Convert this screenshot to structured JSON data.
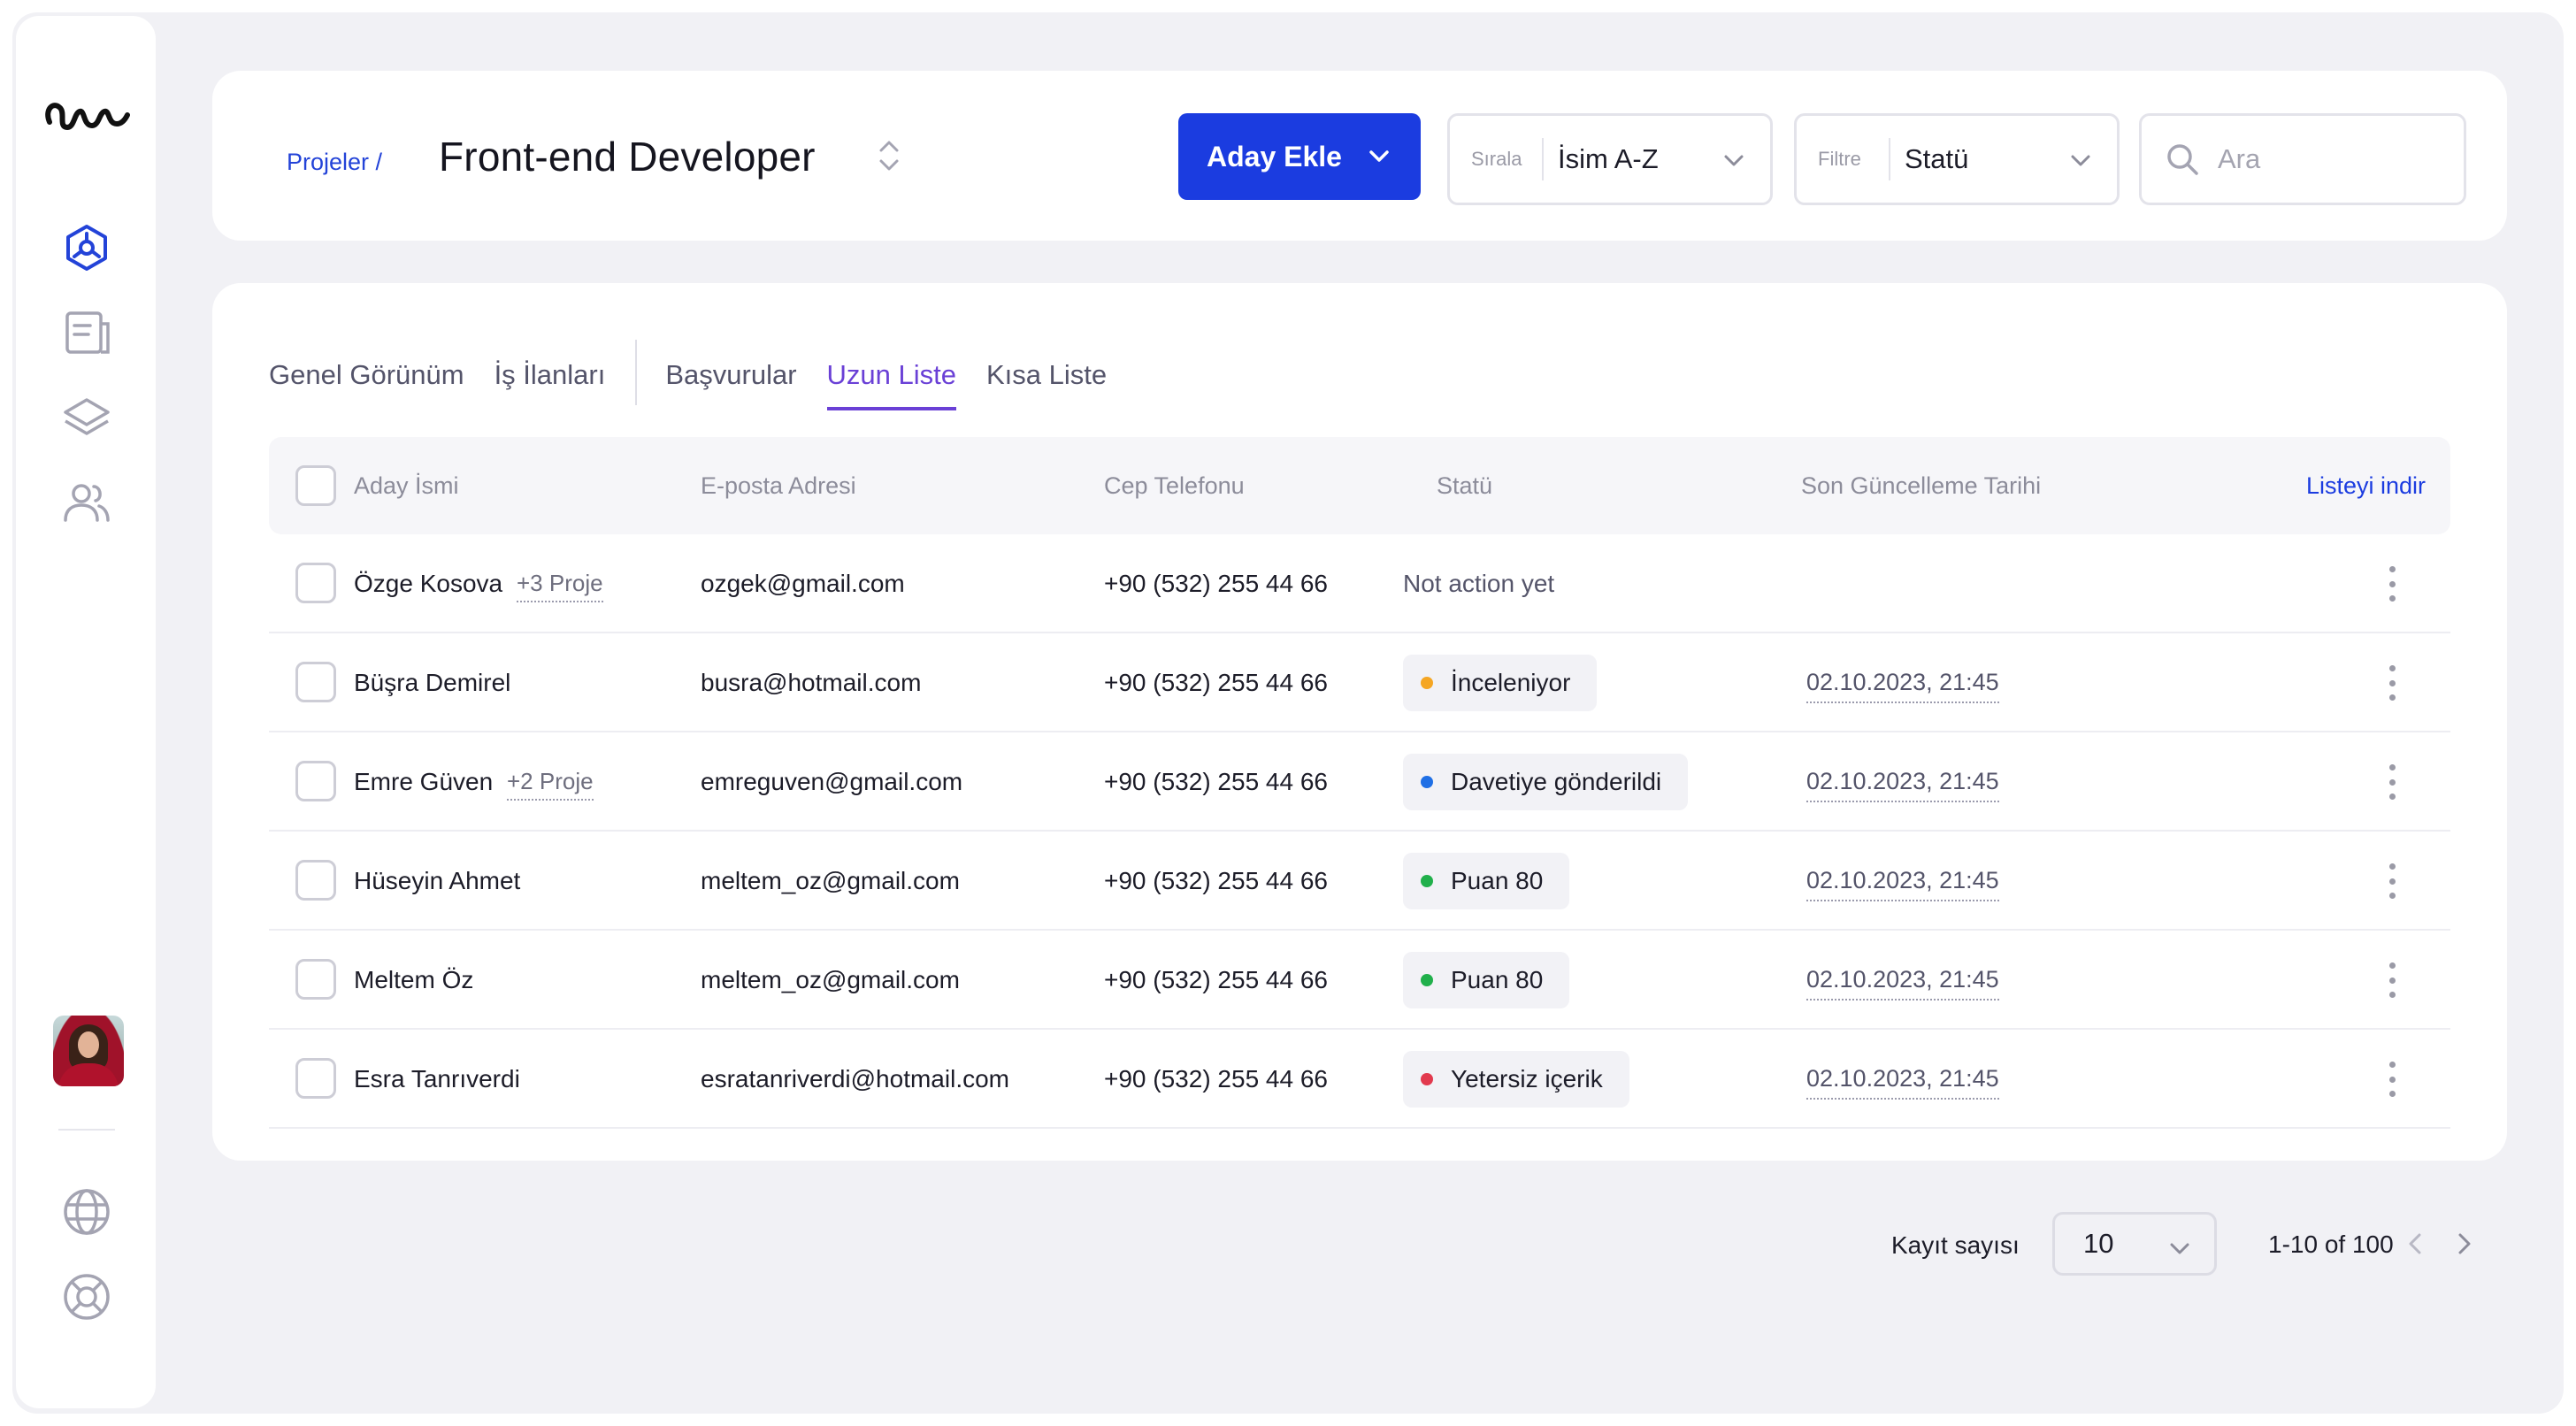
{
  "sidebar": {
    "icons": [
      "logo-icon",
      "projects-icon",
      "documents-icon",
      "layers-icon",
      "users-icon",
      "globe-icon",
      "support-icon"
    ]
  },
  "header": {
    "breadcrumb": "Projeler /",
    "title": "Front-end Developer",
    "add_button": "Aday Ekle",
    "sort": {
      "label": "Sırala",
      "value": "İsim A-Z"
    },
    "filter": {
      "label": "Filtre",
      "value": "Statü"
    },
    "search_placeholder": "Ara"
  },
  "tabs": [
    {
      "label": "Genel Görünüm",
      "active": false
    },
    {
      "label": "İş İlanları",
      "active": false
    },
    {
      "label": "Başvurular",
      "active": false
    },
    {
      "label": "Uzun Liste",
      "active": true
    },
    {
      "label": "Kısa Liste",
      "active": false
    }
  ],
  "table": {
    "columns": [
      "Aday İsmi",
      "E-posta Adresi",
      "Cep Telefonu",
      "Statü",
      "Son Güncelleme Tarihi"
    ],
    "download_label": "Listeyi indir",
    "rows": [
      {
        "name": "Özge Kosova",
        "projects": "+3 Proje",
        "email": "ozgek@gmail.com",
        "phone": "+90 (532) 255 44 66",
        "status": "Not action yet",
        "status_color": "",
        "date": ""
      },
      {
        "name": "Büşra Demirel",
        "projects": "",
        "email": "busra@hotmail.com",
        "phone": "+90 (532) 255 44 66",
        "status": "İnceleniyor",
        "status_color": "#f5a623",
        "date": "02.10.2023, 21:45"
      },
      {
        "name": "Emre Güven",
        "projects": "+2 Proje",
        "email": "emreguven@gmail.com",
        "phone": "+90 (532) 255 44 66",
        "status": "Davetiye gönderildi",
        "status_color": "#1f6fe5",
        "date": "02.10.2023, 21:45"
      },
      {
        "name": "Hüseyin Ahmet",
        "projects": "",
        "email": "meltem_oz@gmail.com",
        "phone": "+90 (532) 255 44 66",
        "status": "Puan 80",
        "status_color": "#21b04b",
        "date": "02.10.2023, 21:45"
      },
      {
        "name": "Meltem Öz",
        "projects": "",
        "email": "meltem_oz@gmail.com",
        "phone": "+90 (532) 255 44 66",
        "status": "Puan 80",
        "status_color": "#21b04b",
        "date": "02.10.2023, 21:45"
      },
      {
        "name": "Esra Tanrıverdi",
        "projects": "",
        "email": "esratanriverdi@hotmail.com",
        "phone": "+90 (532) 255 44 66",
        "status": "Yetersiz içerik",
        "status_color": "#e23a4e",
        "date": "02.10.2023, 21:45"
      }
    ]
  },
  "pagination": {
    "records_label": "Kayıt sayısı",
    "page_size": "10",
    "range": "1-10 of 100"
  },
  "colors": {
    "primary": "#1b3ce0",
    "active_tab": "#6a40d6",
    "background": "#f1f1f5"
  }
}
